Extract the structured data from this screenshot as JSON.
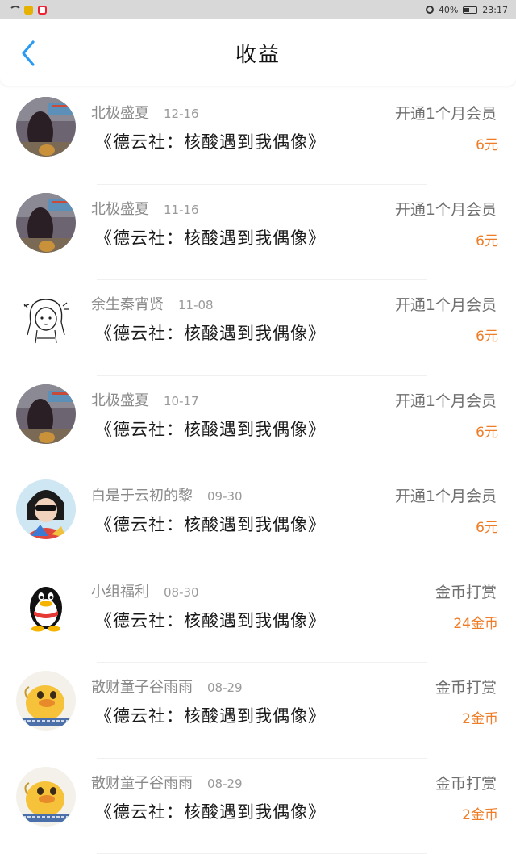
{
  "status": {
    "battery": "40%",
    "time": "23:17"
  },
  "header": {
    "title": "收益"
  },
  "colors": {
    "accent": "#2b9af3",
    "amount": "#ef7d27"
  },
  "items": [
    {
      "avatar": "photo-dark",
      "name": "北极盛夏",
      "date": "12-16",
      "book": "《德云社：核酸遇到我偶像》",
      "type": "开通1个月会员",
      "amount": "6元"
    },
    {
      "avatar": "photo-dark",
      "name": "北极盛夏",
      "date": "11-16",
      "book": "《德云社：核酸遇到我偶像》",
      "type": "开通1个月会员",
      "amount": "6元"
    },
    {
      "avatar": "sketch-girl",
      "name": "余生秦宵贤",
      "date": "11-08",
      "book": "《德云社：核酸遇到我偶像》",
      "type": "开通1个月会员",
      "amount": "6元"
    },
    {
      "avatar": "photo-dark",
      "name": "北极盛夏",
      "date": "10-17",
      "book": "《德云社：核酸遇到我偶像》",
      "type": "开通1个月会员",
      "amount": "6元"
    },
    {
      "avatar": "photo-person",
      "name": "白是于云初的黎",
      "date": "09-30",
      "book": "《德云社：核酸遇到我偶像》",
      "type": "开通1个月会员",
      "amount": "6元"
    },
    {
      "avatar": "penguin",
      "name": "小组福利",
      "date": "08-30",
      "book": "《德云社：核酸遇到我偶像》",
      "type": "金币打赏",
      "amount": "24金币"
    },
    {
      "avatar": "duck",
      "name": "散财童子谷雨雨",
      "date": "08-29",
      "book": "《德云社：核酸遇到我偶像》",
      "type": "金币打赏",
      "amount": "2金币"
    },
    {
      "avatar": "duck",
      "name": "散财童子谷雨雨",
      "date": "08-29",
      "book": "《德云社：核酸遇到我偶像》",
      "type": "金币打赏",
      "amount": "2金币"
    }
  ]
}
